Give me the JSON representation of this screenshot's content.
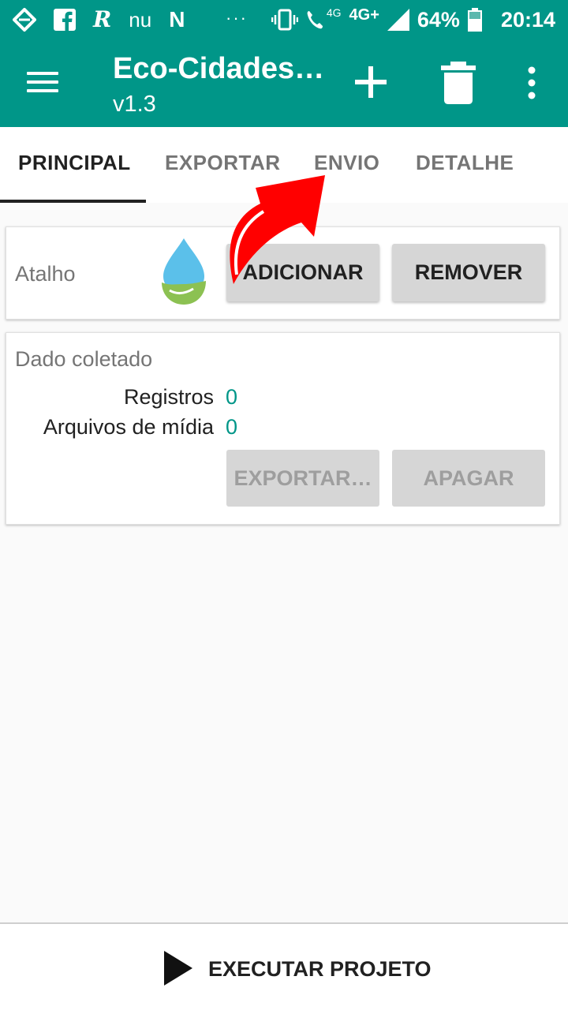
{
  "status_bar": {
    "left_icons": [
      "bank-icon",
      "facebook-icon",
      "r-app-icon",
      "nu-icon",
      "n-app-icon"
    ],
    "r_letter": "R",
    "nu_text": "nu",
    "n_letter": "N",
    "dots": "···",
    "network_small": "4G",
    "network": "4G+",
    "battery": "64%",
    "time": "20:14"
  },
  "app_bar": {
    "title": "Eco-Cidades…",
    "version": "v1.3"
  },
  "tabs": [
    {
      "label": "PRINCIPAL",
      "active": true
    },
    {
      "label": "EXPORTAR",
      "active": false
    },
    {
      "label": "ENVIO",
      "active": false
    },
    {
      "label": "DETALHE",
      "active": false
    }
  ],
  "shortcut_card": {
    "label": "Atalho",
    "add_button": "ADICIONAR",
    "remove_button": "REMOVER"
  },
  "data_card": {
    "title": "Dado coletado",
    "records_label": "Registros",
    "records_value": "0",
    "media_label": "Arquivos de mídia",
    "media_value": "0",
    "export_button": "EXPORTAR…",
    "delete_button": "APAGAR"
  },
  "bottom_bar": {
    "run_label": "EXECUTAR PROJETO"
  },
  "colors": {
    "primary": "#009688",
    "annotation_arrow": "#ff0000"
  }
}
